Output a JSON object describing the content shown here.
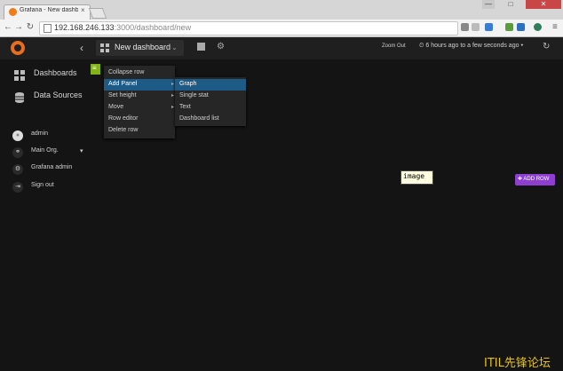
{
  "browser": {
    "tab_title": "Grafana - New dashbo...",
    "tab_close": "×",
    "window_controls": {
      "minimize": "—",
      "maximize": "□",
      "close": "✕"
    },
    "nav": {
      "back": "←",
      "forward": "→",
      "reload": "↻"
    },
    "url_host": "192.168.246.133",
    "url_rest": ":3000/dashboard/new",
    "menu_icon": "≡"
  },
  "topbar": {
    "back_icon": "‹",
    "dashboard_title": "New dashboard",
    "title_caret": "⌄",
    "gear_icon": "⚙",
    "zoom_out": "Zoom Out",
    "time_range": "⏲ 6 hours ago to a few seconds ago ▾",
    "refresh_icon": "↻"
  },
  "sidemenu": {
    "items": [
      {
        "label": "Dashboards",
        "icon": "grid-icon"
      },
      {
        "label": "Data Sources",
        "icon": "database-icon"
      }
    ],
    "profile": [
      {
        "label": "admin",
        "icon": "user-avatar-icon",
        "glyph": "●"
      },
      {
        "label": "Main Org.",
        "icon": "users-icon",
        "glyph": "⚭"
      },
      {
        "label": "Grafana admin",
        "icon": "cog-icon",
        "glyph": "⚙"
      },
      {
        "label": "Sign out",
        "icon": "sign-out-icon",
        "glyph": "⇥"
      }
    ],
    "org_caret": "▾"
  },
  "row_handle_glyph": "≡",
  "row_menu": {
    "items": [
      {
        "label": "Collapse row"
      },
      {
        "label": "Add Panel",
        "arrow": "▸",
        "active": true
      },
      {
        "label": "Set height",
        "arrow": "▸"
      },
      {
        "label": "Move",
        "arrow": "▸"
      },
      {
        "label": "Row editor"
      },
      {
        "label": "Delete row"
      }
    ]
  },
  "add_panel_menu": {
    "items": [
      {
        "label": "Graph",
        "active": true
      },
      {
        "label": "Single stat"
      },
      {
        "label": "Text"
      },
      {
        "label": "Dashboard list"
      }
    ]
  },
  "image_label": "image",
  "add_row_label": "✚ ADD ROW",
  "watermark": "ITIL先锋论坛",
  "colors": {
    "accent": "#8e3fcf",
    "active_menu": "#1e5a86",
    "row_handle": "#82b418",
    "logo": "#e86d1f"
  }
}
